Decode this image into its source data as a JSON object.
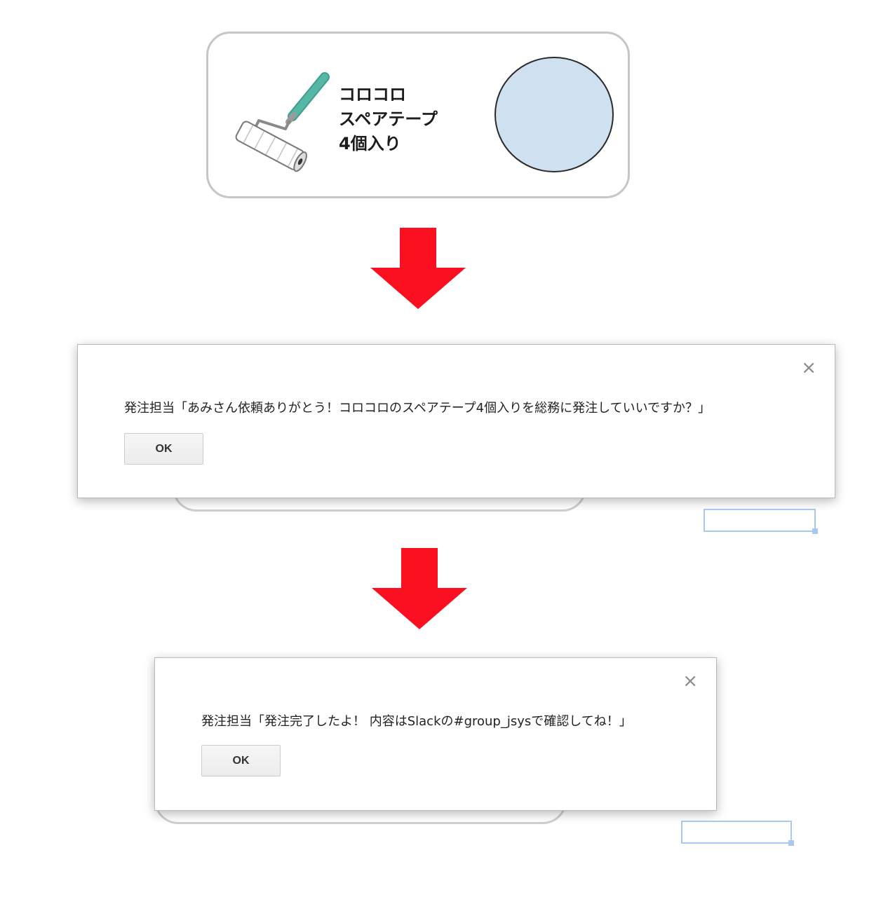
{
  "product_card": {
    "name_lines": [
      "コロコロ",
      "スペアテープ",
      "4個入り"
    ]
  },
  "dialog1": {
    "message": "発注担当「あみさん依頼ありがとう！コロコロのスペアテープ4個入りを総務に発注していいですか？」",
    "ok_label": "OK",
    "close_glyph": "×"
  },
  "dialog2": {
    "message": "発注担当「発注完了したよ！ 内容はSlackの#group_jsysで確認してね！」",
    "ok_label": "OK",
    "close_glyph": "×"
  },
  "colors": {
    "arrow": "#fb1021",
    "circle_fill": "#cfe1f1",
    "roller_handle": "#4fb3a1",
    "selection": "#a9c8ef"
  },
  "icons": {
    "product": "lint-roller-icon",
    "arrow": "arrow-down-icon",
    "close": "close-icon"
  }
}
